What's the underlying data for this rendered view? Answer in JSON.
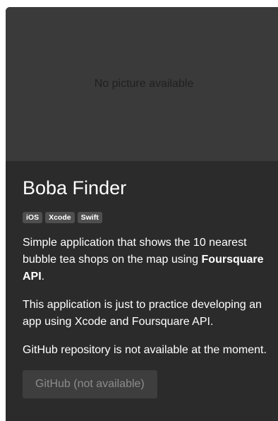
{
  "card": {
    "image_placeholder_text": "No picture available",
    "title": "Boba Finder",
    "tags": [
      "iOS",
      "Xcode",
      "Swift"
    ],
    "description_1": {
      "before": "Simple application that shows the 10 nearest bubble tea shops on the map using ",
      "bold": "Foursquare API",
      "after": "."
    },
    "description_2": "This application is just to practice developing an app using Xcode and Foursquare API.",
    "description_3": "GitHub repository is not available at the moment.",
    "github_button_label": "GitHub (not available)"
  }
}
